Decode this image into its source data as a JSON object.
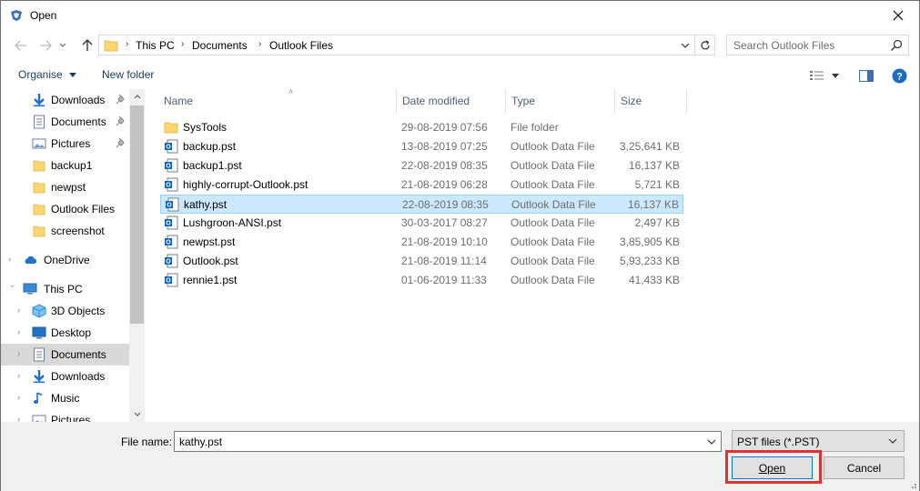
{
  "window": {
    "title": "Open"
  },
  "address": {
    "crumbs": [
      "This PC",
      "Documents",
      "Outlook Files"
    ]
  },
  "search": {
    "placeholder": "Search Outlook Files"
  },
  "toolbar": {
    "organise": "Organise",
    "new_folder": "New folder"
  },
  "sidebar": {
    "items": [
      {
        "label": "Downloads",
        "icon": "downloads-icon",
        "pinned": true
      },
      {
        "label": "Documents",
        "icon": "documents-icon",
        "pinned": true
      },
      {
        "label": "Pictures",
        "icon": "pictures-icon",
        "pinned": true
      },
      {
        "label": "backup1",
        "icon": "folder-icon",
        "pinned": false
      },
      {
        "label": "newpst",
        "icon": "folder-icon",
        "pinned": false
      },
      {
        "label": "Outlook Files",
        "icon": "folder-icon",
        "pinned": false
      },
      {
        "label": "screenshot",
        "icon": "folder-icon",
        "pinned": false
      },
      {
        "label": "OneDrive",
        "icon": "cloud-icon",
        "pinned": false
      },
      {
        "label": "This PC",
        "icon": "computer-icon",
        "pinned": false
      },
      {
        "label": "3D Objects",
        "icon": "3d-objects-icon",
        "pinned": false
      },
      {
        "label": "Desktop",
        "icon": "desktop-icon",
        "pinned": false
      },
      {
        "label": "Documents",
        "icon": "documents-icon",
        "pinned": false
      },
      {
        "label": "Downloads",
        "icon": "downloads-icon",
        "pinned": false
      },
      {
        "label": "Music",
        "icon": "music-icon",
        "pinned": false
      },
      {
        "label": "Pictures",
        "icon": "pictures-icon",
        "pinned": false
      }
    ]
  },
  "columns": {
    "name": "Name",
    "date": "Date modified",
    "type": "Type",
    "size": "Size"
  },
  "files": [
    {
      "name": "SysTools",
      "date": "29-08-2019 07:56",
      "type": "File folder",
      "size": "",
      "icon": "folder-icon"
    },
    {
      "name": "backup.pst",
      "date": "13-08-2019 07:25",
      "type": "Outlook Data File",
      "size": "3,25,641 KB",
      "icon": "outlook-file-icon"
    },
    {
      "name": "backup1.pst",
      "date": "22-08-2019 08:35",
      "type": "Outlook Data File",
      "size": "16,137 KB",
      "icon": "outlook-file-icon"
    },
    {
      "name": "highly-corrupt-Outlook.pst",
      "date": "21-08-2019 06:28",
      "type": "Outlook Data File",
      "size": "5,721 KB",
      "icon": "outlook-file-icon"
    },
    {
      "name": "kathy.pst",
      "date": "22-08-2019 08:35",
      "type": "Outlook Data File",
      "size": "16,137 KB",
      "icon": "outlook-file-icon"
    },
    {
      "name": "Lushgroon-ANSI.pst",
      "date": "30-03-2017 08:27",
      "type": "Outlook Data File",
      "size": "2,497 KB",
      "icon": "outlook-file-icon"
    },
    {
      "name": "newpst.pst",
      "date": "21-08-2019 10:10",
      "type": "Outlook Data File",
      "size": "3,85,905 KB",
      "icon": "outlook-file-icon"
    },
    {
      "name": "Outlook.pst",
      "date": "21-08-2019 11:14",
      "type": "Outlook Data File",
      "size": "5,93,233 KB",
      "icon": "outlook-file-icon"
    },
    {
      "name": "rennie1.pst",
      "date": "01-06-2019 11:33",
      "type": "Outlook Data File",
      "size": "41,433 KB",
      "icon": "outlook-file-icon"
    }
  ],
  "selected_file": "kathy.pst",
  "footer": {
    "file_name_label": "File name:",
    "file_name_value": "kathy.pst",
    "file_type": "PST files (*.PST)",
    "open_label": "Open",
    "cancel_label": "Cancel"
  },
  "colors": {
    "selection": "#cce8ff",
    "accent": "#0078d7",
    "highlight": "#e03131"
  }
}
